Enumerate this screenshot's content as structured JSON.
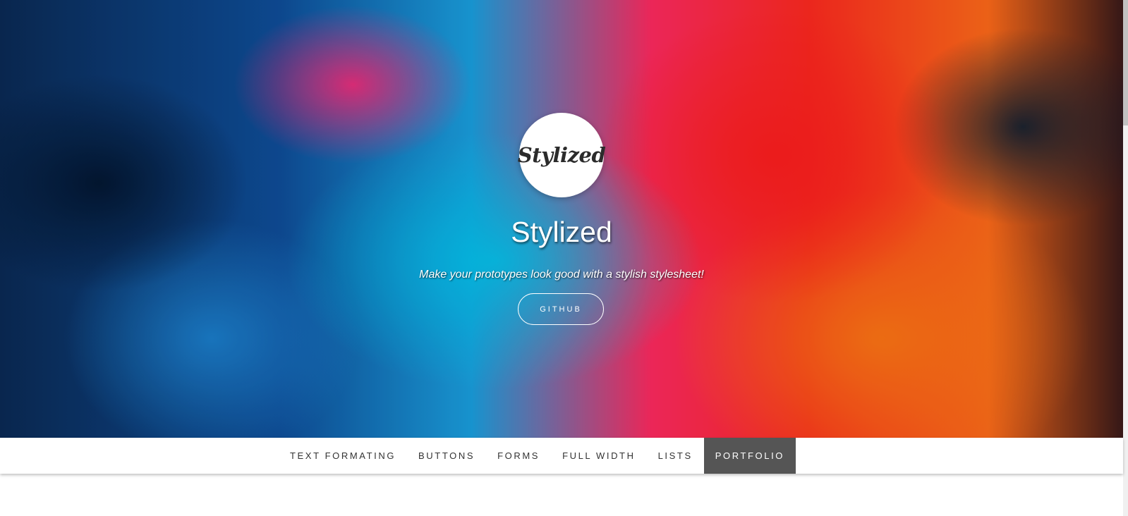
{
  "hero": {
    "logo_text": "Stylized",
    "title": "Stylized",
    "subtitle": "Make your prototypes look good with a stylish stylesheet!",
    "button_label": "GITHUB"
  },
  "nav": {
    "items": [
      {
        "label": "TEXT FORMATING",
        "active": false
      },
      {
        "label": "BUTTONS",
        "active": false
      },
      {
        "label": "FORMS",
        "active": false
      },
      {
        "label": "FULL WIDTH",
        "active": false
      },
      {
        "label": "LISTS",
        "active": false
      },
      {
        "label": "PORTFOLIO",
        "active": true
      }
    ]
  },
  "colors": {
    "nav_active_bg": "#555555",
    "nav_text": "#333333",
    "hero_text": "#ffffff"
  }
}
